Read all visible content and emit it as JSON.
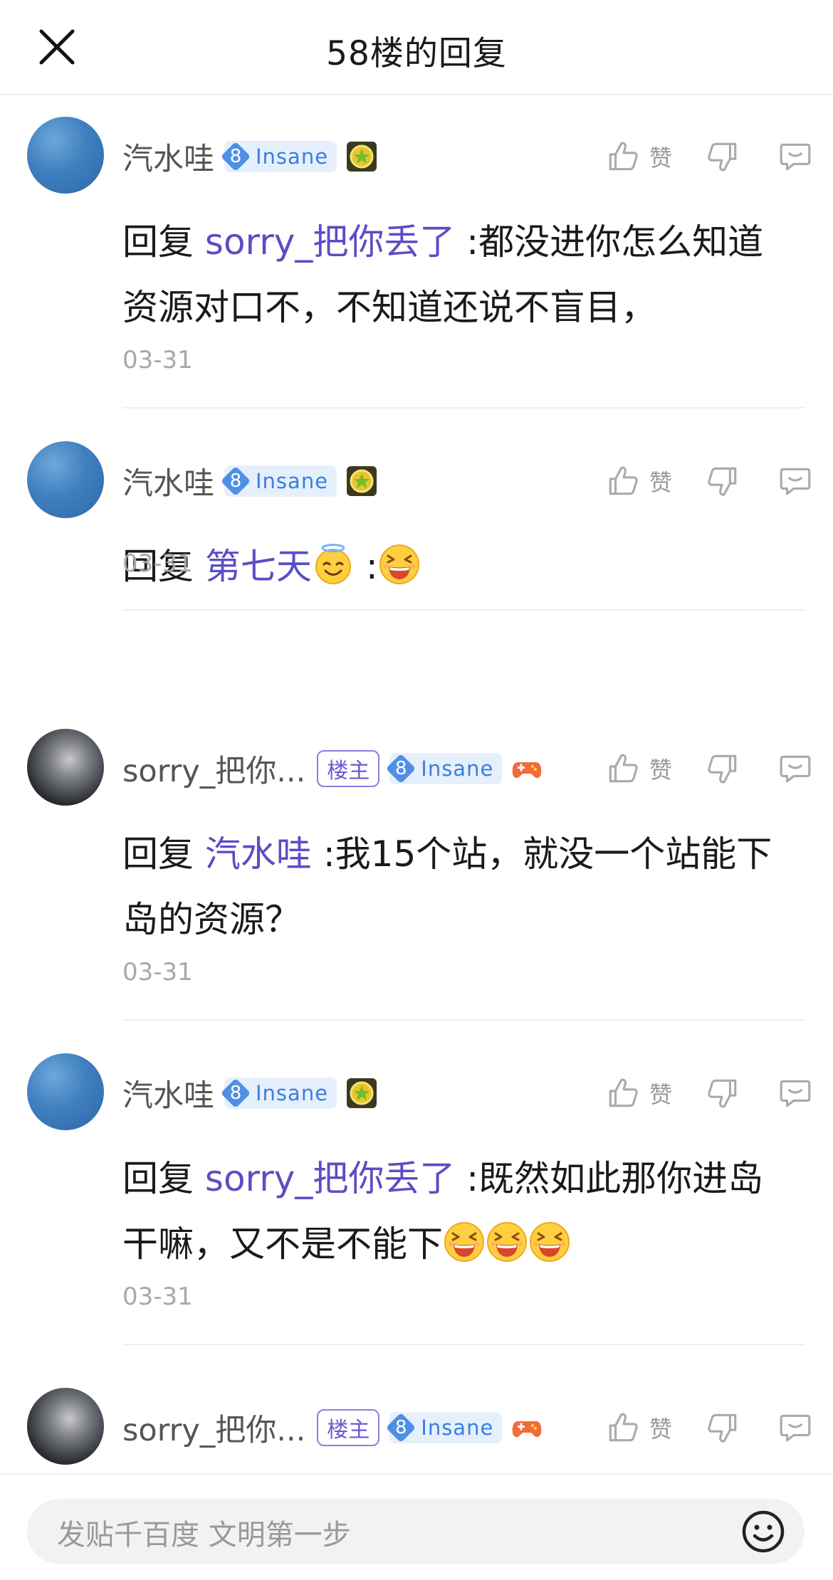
{
  "header": {
    "title": "58楼的回复"
  },
  "actions": {
    "like_label": "赞"
  },
  "replies": [
    {
      "user": "汽水哇",
      "is_op": false,
      "level": "8",
      "level_name": "Insane",
      "prefix": "回复",
      "reply_to": "sorry_把你丢了",
      "text": ":都没进你怎么知道资源对口不，不知道还说不盲目，",
      "date": "03-31"
    },
    {
      "user": "汽水哇",
      "is_op": false,
      "level": "8",
      "level_name": "Insane",
      "prefix": "回复",
      "reply_to": "第七天",
      "text": ":",
      "date": "03-31"
    },
    {
      "user": "sorry_把你...",
      "is_op": true,
      "op_label": "楼主",
      "level": "8",
      "level_name": "Insane",
      "prefix": "回复",
      "reply_to": "汽水哇",
      "text": ":我15个站，就没一个站能下岛的资源？",
      "date": "03-31"
    },
    {
      "user": "汽水哇",
      "is_op": false,
      "level": "8",
      "level_name": "Insane",
      "prefix": "回复",
      "reply_to": "sorry_把你丢了",
      "text": ":既然如此那你进岛干嘛，又不是不能下",
      "date": "03-31"
    },
    {
      "user": "sorry_把你...",
      "is_op": true,
      "op_label": "楼主",
      "level": "8",
      "level_name": "Insane"
    }
  ],
  "footer": {
    "input_placeholder": "发贴千百度 文明第一步"
  },
  "icons": [
    "close-icon",
    "thumbs-up-icon",
    "thumbs-down-icon",
    "comment-icon",
    "medal-icon",
    "game-controller-icon",
    "smile-emoji-icon",
    "laughing-emoji-icon",
    "halo-emoji-icon"
  ]
}
